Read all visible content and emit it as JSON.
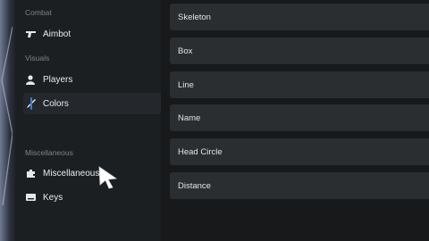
{
  "sidebar": {
    "sections": {
      "combat": "Combat",
      "visuals": "Visuals",
      "misc": "Miscellaneous"
    },
    "items": [
      {
        "label": "Aimbot",
        "icon": "gun-icon"
      },
      {
        "label": "Players",
        "icon": "person-icon"
      },
      {
        "label": "Colors",
        "icon": "brush-icon",
        "active": true
      },
      {
        "label": "Miscellaneous",
        "icon": "puzzle-icon"
      },
      {
        "label": "Keys",
        "icon": "keyboard-icon"
      }
    ]
  },
  "content": {
    "fields": [
      {
        "label": "Skeleton"
      },
      {
        "label": "Box"
      },
      {
        "label": "Line"
      },
      {
        "label": "Name"
      },
      {
        "label": "Head Circle"
      },
      {
        "label": "Distance"
      }
    ]
  },
  "colors": {
    "background": "#1c1f22",
    "panel": "#17191b",
    "field": "#2a2e31",
    "accent": "#3a7bd5"
  }
}
